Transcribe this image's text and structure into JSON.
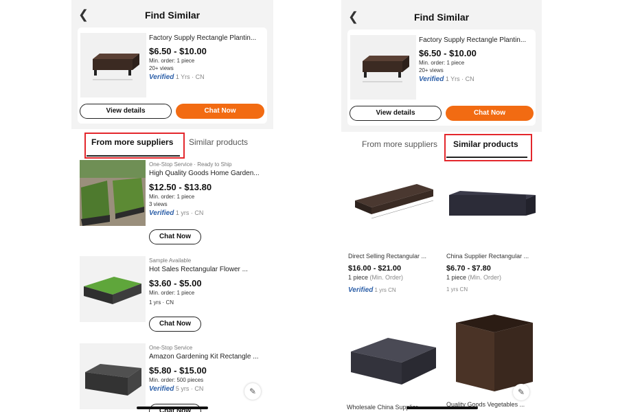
{
  "colors": {
    "accent": "#f26b12",
    "highlight": "#e3262b",
    "verified": "#2c5fa8"
  },
  "left": {
    "title": "Find Similar",
    "product": {
      "name": "Factory Supply Rectangle Plantin...",
      "price": "$6.50 - $10.00",
      "min_order": "Min. order: 1 piece",
      "views": "20+ views",
      "verified": "Verified",
      "supplier": "1 Yrs · CN",
      "view_details": "View details",
      "chat": "Chat Now"
    },
    "tabs": [
      "From more suppliers",
      "Similar products"
    ],
    "items": [
      {
        "tag": "One-Stop Service · Ready to Ship",
        "name": "High Quality Goods Home Garden...",
        "price": "$12.50 - $13.80",
        "min_order": "Min. order: 1 piece",
        "views": "3 views",
        "verified": "Verified",
        "supplier": "1 yrs · CN",
        "chat": "Chat Now"
      },
      {
        "tag": "Sample Available",
        "name": "Hot Sales Rectangular Flower ...",
        "price": "$3.60 - $5.00",
        "min_order": "Min. order: 1 piece",
        "supplier": "1 yrs · CN",
        "chat": "Chat Now"
      },
      {
        "tag": "One-Stop Service",
        "name": "Amazon Gardening Kit Rectangle ...",
        "price": "$5.80 - $15.00",
        "min_order": "Min. order: 500 pieces",
        "verified": "Verified",
        "supplier": "5 yrs · CN",
        "chat": "Chat Now"
      }
    ]
  },
  "right": {
    "title": "Find Similar",
    "product": {
      "name": "Factory Supply Rectangle Plantin...",
      "price": "$6.50 - $10.00",
      "min_order": "Min. order: 1 piece",
      "views": "20+ views",
      "verified": "Verified",
      "supplier": "1 Yrs · CN",
      "view_details": "View details",
      "chat": "Chat Now"
    },
    "tabs": [
      "From more suppliers",
      "Similar products"
    ],
    "grid": [
      {
        "name": "Direct Selling Rectangular ...",
        "price": "$16.00 - $21.00",
        "qty": "1 piece",
        "qty_note": "(Min. Order)",
        "verified": "Verified",
        "supplier": "1 yrs CN"
      },
      {
        "name": "China Supplier Rectangular ...",
        "price": "$6.70 - $7.80",
        "qty": "1 piece",
        "qty_note": "(Min. Order)",
        "supplier": "1 yrs CN"
      },
      {
        "name": "Wholesale China Supplier...",
        "price": "",
        "qty": "",
        "qty_note": "",
        "supplier": ""
      },
      {
        "name": "Quality Goods Vegetables ...",
        "price": "",
        "qty": "",
        "qty_note": "",
        "supplier": ""
      }
    ]
  }
}
